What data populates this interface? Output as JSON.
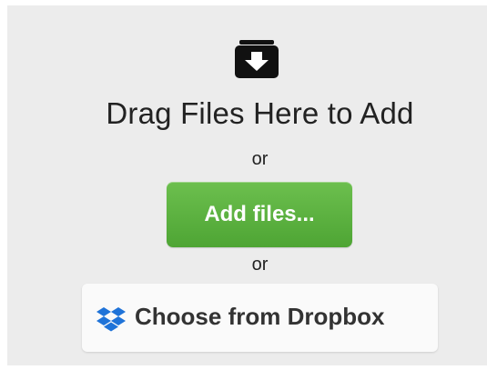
{
  "upload": {
    "heading": "Drag Files Here to Add",
    "or_1": "or",
    "add_button_label": "Add files...",
    "or_2": "or",
    "dropbox_button_label": "Choose from Dropbox",
    "icons": {
      "tray": "download-tray-icon",
      "dropbox": "dropbox-icon"
    }
  },
  "colors": {
    "background": "#ececec",
    "add_button": "#5cb43f",
    "dropbox_blue": "#1f73d8",
    "text": "#222222"
  }
}
